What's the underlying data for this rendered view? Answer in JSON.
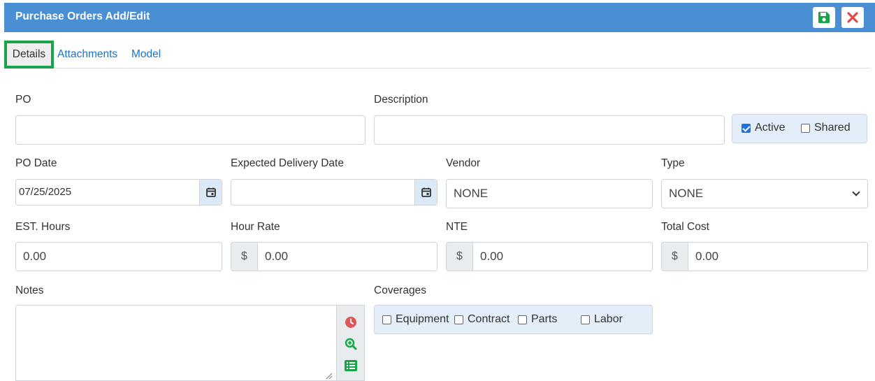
{
  "header": {
    "title": "Purchase Orders Add/Edit",
    "save_icon": "save-icon",
    "close_icon": "close-icon"
  },
  "tabs": [
    {
      "label": "Details",
      "active": true
    },
    {
      "label": "Attachments",
      "active": false
    },
    {
      "label": "Model",
      "active": false
    }
  ],
  "fields": {
    "po": {
      "label": "PO",
      "value": ""
    },
    "description": {
      "label": "Description",
      "value": ""
    },
    "active": {
      "label": "Active",
      "checked": true
    },
    "shared": {
      "label": "Shared",
      "checked": false
    },
    "po_date": {
      "label": "PO Date",
      "value": "07/25/2025"
    },
    "expected_delivery": {
      "label": "Expected Delivery Date",
      "value": ""
    },
    "vendor": {
      "label": "Vendor",
      "value": "NONE"
    },
    "type": {
      "label": "Type",
      "value": "NONE"
    },
    "est_hours": {
      "label": "EST. Hours",
      "value": "0.00"
    },
    "hour_rate": {
      "label": "Hour Rate",
      "prefix": "$",
      "value": "0.00"
    },
    "nte": {
      "label": "NTE",
      "prefix": "$",
      "value": "0.00"
    },
    "total_cost": {
      "label": "Total Cost",
      "prefix": "$",
      "value": "0.00"
    },
    "notes": {
      "label": "Notes",
      "value": ""
    },
    "coverages": {
      "label": "Coverages",
      "options": [
        {
          "label": "Equipment",
          "checked": false
        },
        {
          "label": "Contract",
          "checked": false
        },
        {
          "label": "Parts",
          "checked": false
        },
        {
          "label": "Labor",
          "checked": false
        }
      ]
    }
  },
  "colors": {
    "header_bg": "#4a8fd3",
    "active_tab_border": "#18a54a",
    "link": "#1a73c9",
    "save": "#18a54a",
    "close": "#e04a4a"
  }
}
